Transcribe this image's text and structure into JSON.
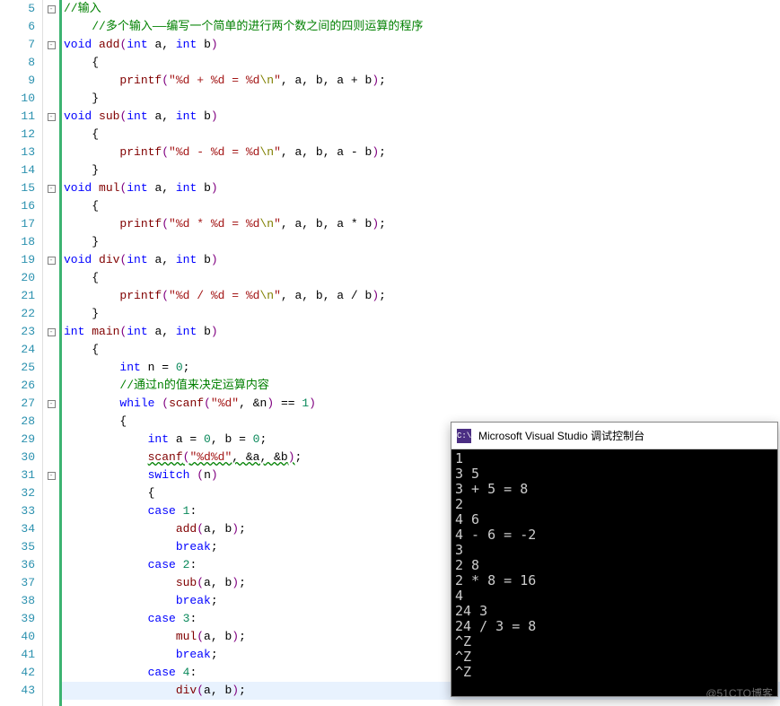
{
  "line_start": 5,
  "line_end": 43,
  "fold_boxes": [
    5,
    7,
    11,
    15,
    19,
    23,
    27,
    31
  ],
  "code": {
    "l5": {
      "t": "//输入",
      "cls": "cmt",
      "indent": 0
    },
    "l6": {
      "t": "//多个输入——编写一个简单的进行两个数之间的四则运算的程序",
      "cls": "cmt",
      "indent": 1
    },
    "l7": {
      "pre": "void ",
      "fn": "add",
      "sig": "(int a, int b)",
      "indent": 0
    },
    "l8": {
      "t": "{",
      "indent": 1
    },
    "l9": {
      "printf": true,
      "fmt": "%d + %d = %d",
      "args": ", a, b, a + b",
      "indent": 2
    },
    "l10": {
      "t": "}",
      "indent": 1
    },
    "l11": {
      "pre": "void ",
      "fn": "sub",
      "sig": "(int a, int b)",
      "indent": 0
    },
    "l12": {
      "t": "{",
      "indent": 1
    },
    "l13": {
      "printf": true,
      "fmt": "%d - %d = %d",
      "args": ", a, b, a - b",
      "indent": 2
    },
    "l14": {
      "t": "}",
      "indent": 1
    },
    "l15": {
      "pre": "void ",
      "fn": "mul",
      "sig": "(int a, int b)",
      "indent": 0
    },
    "l16": {
      "t": "{",
      "indent": 1
    },
    "l17": {
      "printf": true,
      "fmt": "%d * %d = %d",
      "args": ", a, b, a * b",
      "indent": 2
    },
    "l18": {
      "t": "}",
      "indent": 1
    },
    "l19": {
      "pre": "void ",
      "fn": "div",
      "sig": "(int a, int b)",
      "indent": 0
    },
    "l20": {
      "t": "{",
      "indent": 1
    },
    "l21": {
      "printf": true,
      "fmt": "%d / %d = %d",
      "args": ", a, b, a / b",
      "indent": 2
    },
    "l22": {
      "t": "}",
      "indent": 1
    },
    "l23": {
      "pre": "int ",
      "fn": "main",
      "sig": "(int a, int b)",
      "indent": 0
    },
    "l24": {
      "t": "{",
      "indent": 1
    },
    "l25": {
      "decl": "int n = 0;",
      "indent": 2
    },
    "l26": {
      "t": "//通过n的值来决定运算内容",
      "cls": "cmt",
      "indent": 2
    },
    "l27": {
      "while": true,
      "cond": "scanf(\"%d\", &n) == 1",
      "indent": 2
    },
    "l28": {
      "t": "{",
      "indent": 2
    },
    "l29": {
      "decl": "int a = 0, b = 0;",
      "indent": 3
    },
    "l30": {
      "scanf": true,
      "fmt": "%d%d",
      "args": ", &a, &b",
      "wave": true,
      "indent": 3
    },
    "l31": {
      "switch": true,
      "expr": "n",
      "indent": 3
    },
    "l32": {
      "t": "{",
      "indent": 3
    },
    "l33": {
      "case": "1",
      "indent": 3
    },
    "l34": {
      "call": "add",
      "args": "a, b",
      "indent": 4
    },
    "l35": {
      "break": true,
      "indent": 4
    },
    "l36": {
      "case": "2",
      "indent": 3
    },
    "l37": {
      "call": "sub",
      "args": "a, b",
      "indent": 4
    },
    "l38": {
      "break": true,
      "indent": 4
    },
    "l39": {
      "case": "3",
      "indent": 3
    },
    "l40": {
      "call": "mul",
      "args": "a, b",
      "indent": 4
    },
    "l41": {
      "break": true,
      "indent": 4
    },
    "l42": {
      "case": "4",
      "indent": 3
    },
    "l43": {
      "call": "div",
      "args": "a, b",
      "indent": 4,
      "hl": true
    }
  },
  "console": {
    "icon_text": "C:\\",
    "title": "Microsoft Visual Studio 调试控制台",
    "lines": [
      "1",
      "3 5",
      "3 + 5 = 8",
      "2",
      "4 6",
      "4 - 6 = -2",
      "3",
      "2 8",
      "2 * 8 = 16",
      "4",
      "24 3",
      "24 / 3 = 8",
      "^Z",
      "^Z",
      "^Z"
    ]
  },
  "watermark": "@51CTO博客"
}
